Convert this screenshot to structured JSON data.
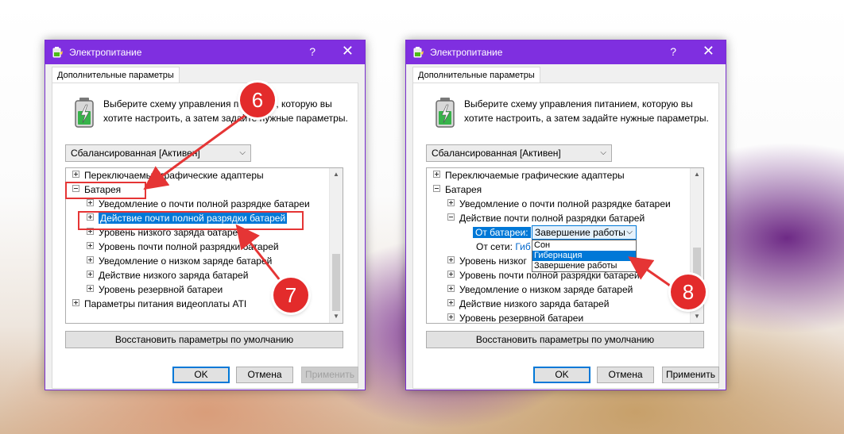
{
  "dialogs": {
    "left": {
      "title": "Электропитание",
      "help_label": "?",
      "close_label": "✕",
      "tab_label": "Дополнительные параметры",
      "description": "Выберите схему управления питанием, которую вы хотите настроить, а затем задайте нужные параметры.",
      "scheme": "Сбалансированная [Активен]",
      "tree": [
        "Переключаемые графические адаптеры",
        "Батарея",
        "Уведомление о почти полной разрядке батареи",
        "Действие почти полной разрядки батарей",
        "Уровень низкого заряда батареи",
        "Уровень почти полной разрядки батарей",
        "Уведомление о низком заряде батарей",
        "Действие низкого заряда батарей",
        "Уровень резервной батареи",
        "Параметры питания видеоплаты ATI"
      ],
      "restore_label": "Восстановить параметры по умолчанию",
      "ok_label": "OK",
      "cancel_label": "Отмена",
      "apply_label": "Применить"
    },
    "right": {
      "title": "Электропитание",
      "help_label": "?",
      "close_label": "✕",
      "tab_label": "Дополнительные параметры",
      "description": "Выберите схему управления питанием, которую вы хотите настроить, а затем задайте нужные параметры.",
      "scheme": "Сбалансированная [Активен]",
      "tree": [
        "Переключаемые графические адаптеры",
        "Батарея",
        "Уведомление о почти полной разрядке батареи",
        "Действие почти полной разрядки батарей",
        "Уровень низког",
        "Уровень почти полной разрядки батарей",
        "Уведомление о низком заряде батарей",
        "Действие низкого заряда батарей",
        "Уровень резервной батареи"
      ],
      "on_battery_label": "От батареи:",
      "on_battery_value": "Завершение работы",
      "plugged_in_label": "От сети:",
      "plugged_in_value": "Гиб",
      "dropdown_options": [
        "Сон",
        "Гибернация",
        "Завершение работы"
      ],
      "restore_label": "Восстановить параметры по умолчанию",
      "ok_label": "OK",
      "cancel_label": "Отмена",
      "apply_label": "Применить"
    }
  },
  "annotations": [
    "6",
    "7",
    "8"
  ],
  "colors": {
    "titlebar": "#7f2fe0",
    "selection": "#0078d7",
    "annotation": "#e32b2b"
  }
}
